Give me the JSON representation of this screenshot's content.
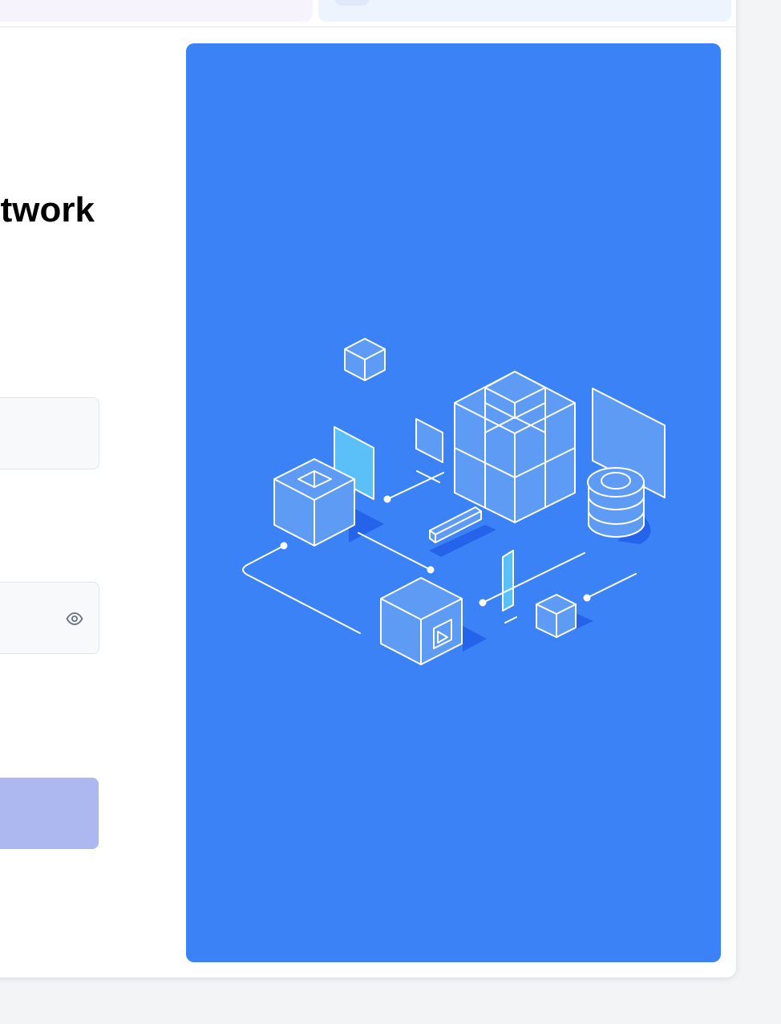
{
  "login": {
    "heading_fragment": "twork",
    "icons": {
      "eye": "eye-icon"
    },
    "colors": {
      "accent": "#3b82f6",
      "button_disabled": "#adb8f1",
      "input_bg": "#f8f9fb"
    }
  },
  "illustration": {
    "name": "isometric-network-cubes",
    "bg_color": "#3b82f6"
  }
}
